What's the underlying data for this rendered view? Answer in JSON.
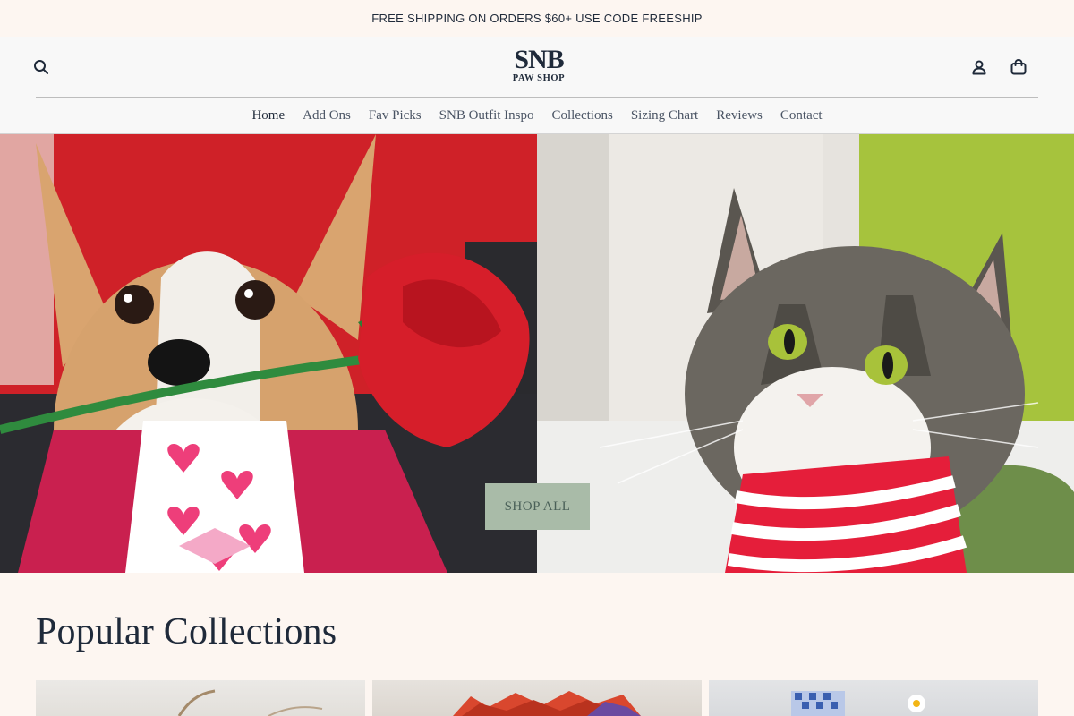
{
  "announcement": {
    "text": "FREE SHIPPING ON ORDERS $60+ USE CODE FREESHIP"
  },
  "header": {
    "logo_main": "SNB",
    "logo_sub": "PAW SHOP",
    "icons": {
      "search": "search-icon",
      "account": "user-icon",
      "cart": "shopping-bag-icon"
    }
  },
  "nav": {
    "items": [
      {
        "label": "Home",
        "active": true
      },
      {
        "label": "Add Ons"
      },
      {
        "label": "Fav Picks"
      },
      {
        "label": "SNB Outfit Inspo"
      },
      {
        "label": "Collections"
      },
      {
        "label": "Sizing Chart"
      },
      {
        "label": "Reviews"
      },
      {
        "label": "Contact"
      }
    ]
  },
  "hero": {
    "cta_label": "SHOP ALL",
    "colors": {
      "cta_bg": "#a9bba8",
      "cta_text": "#4a6058"
    }
  },
  "popular": {
    "title": "Popular Collections"
  },
  "theme": {
    "background": "#fdf6f1",
    "text": "#1f2a3a",
    "header_bg": "#f8f8f8"
  }
}
